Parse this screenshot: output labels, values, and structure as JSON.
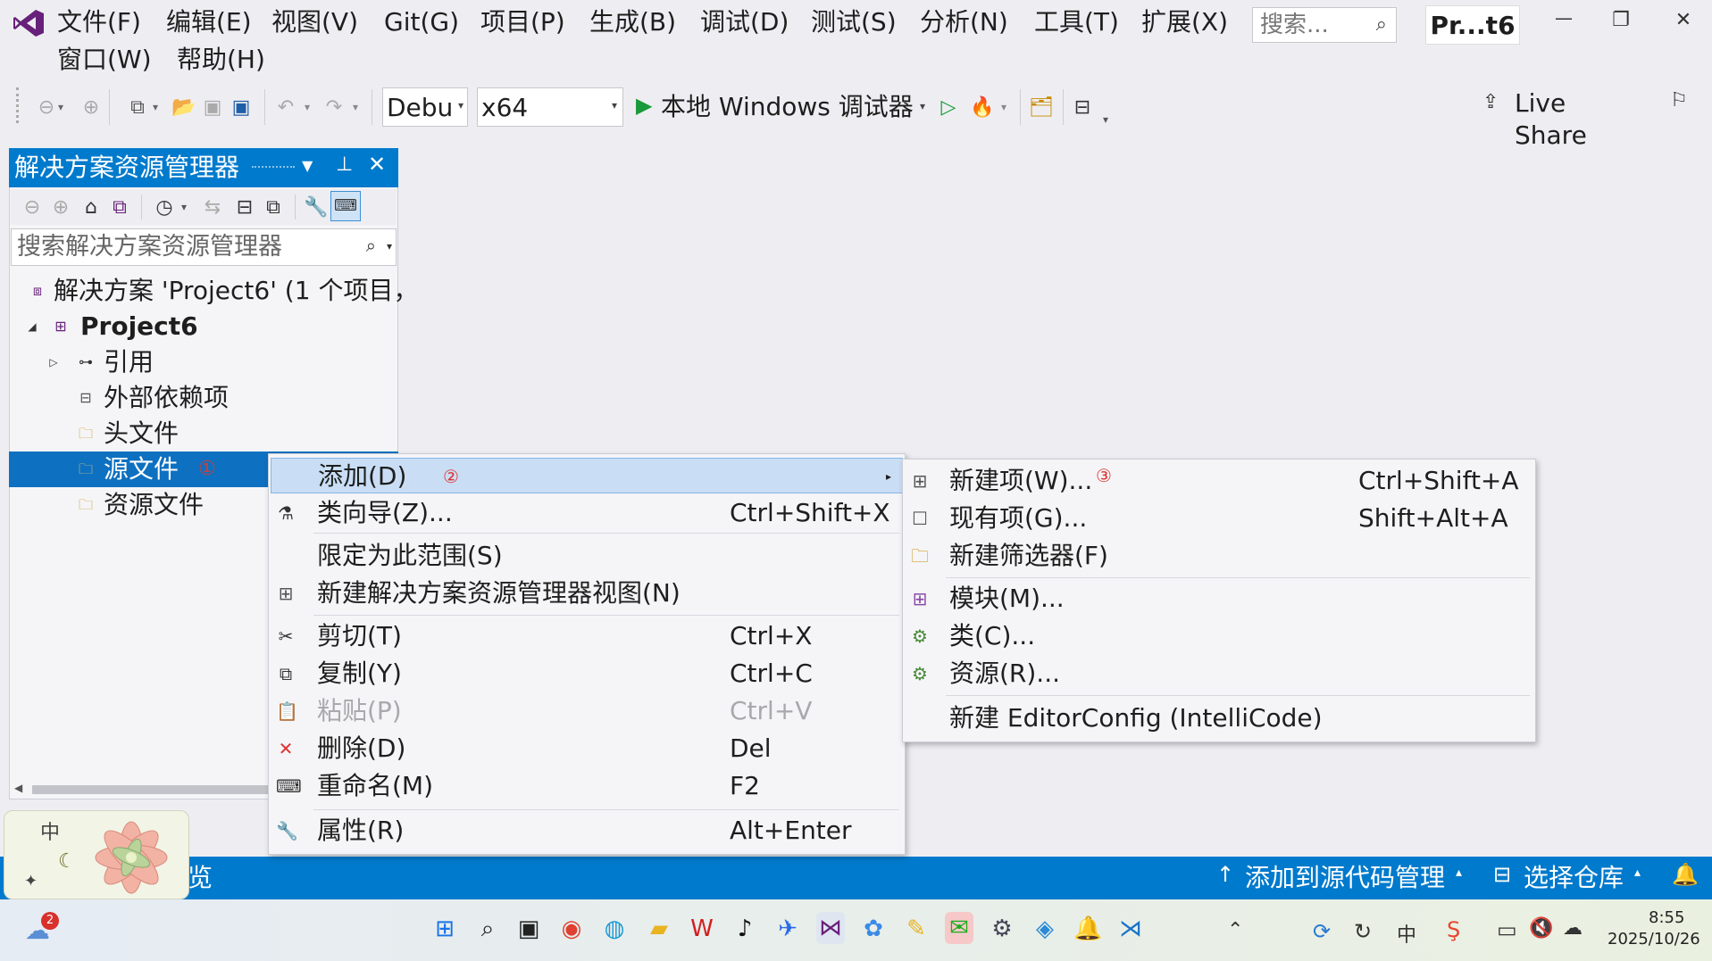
{
  "menubar": {
    "items": [
      "文件(F)",
      "编辑(E)",
      "视图(V)",
      "Git(G)",
      "项目(P)",
      "生成(B)",
      "调试(D)",
      "测试(S)",
      "分析(N)",
      "工具(T)",
      "扩展(X)"
    ],
    "items_row2": [
      "窗口(W)",
      "帮助(H)"
    ],
    "search_placeholder": "搜索...",
    "project_badge": "Pr...t6",
    "window_min": "—",
    "window_restore": "❐",
    "window_close": "✕"
  },
  "toolbar": {
    "config": "Debu",
    "platform": "x64",
    "run_label": "本地 Windows 调试器",
    "live_share": "Live Share"
  },
  "solution_explorer": {
    "title": "解决方案资源管理器",
    "search_placeholder": "搜索解决方案资源管理器(Ctrl+;)",
    "search_icon": "magnifier-icon",
    "solution_label": "解决方案 'Project6' (1 个项目，",
    "project": "Project6",
    "items": [
      "引用",
      "外部依赖项",
      "头文件",
      "源文件",
      "资源文件"
    ],
    "selected_marker": "①"
  },
  "context_menu": {
    "items": [
      {
        "label": "添加(D)",
        "marker": "②",
        "shortcut": "",
        "icon": "",
        "submenu": true
      },
      {
        "label": "类向导(Z)...",
        "shortcut": "Ctrl+Shift+X",
        "icon": "class-wizard-icon"
      },
      {
        "label": "限定为此范围(S)",
        "shortcut": "",
        "icon": ""
      },
      {
        "label": "新建解决方案资源管理器视图(N)",
        "shortcut": "",
        "icon": "new-view-icon"
      },
      {
        "label": "剪切(T)",
        "shortcut": "Ctrl+X",
        "icon": "scissors-icon"
      },
      {
        "label": "复制(Y)",
        "shortcut": "Ctrl+C",
        "icon": "copy-icon"
      },
      {
        "label": "粘贴(P)",
        "shortcut": "Ctrl+V",
        "icon": "paste-icon",
        "disabled": true
      },
      {
        "label": "删除(D)",
        "shortcut": "Del",
        "icon": "delete-icon"
      },
      {
        "label": "重命名(M)",
        "shortcut": "F2",
        "icon": "rename-icon"
      },
      {
        "label": "属性(R)",
        "shortcut": "Alt+Enter",
        "icon": "wrench-icon"
      }
    ]
  },
  "submenu": {
    "items": [
      {
        "label": "新建项(W)...",
        "marker": "③",
        "shortcut": "Ctrl+Shift+A",
        "icon": "new-item-icon"
      },
      {
        "label": "现有项(G)...",
        "shortcut": "Shift+Alt+A",
        "icon": "existing-item-icon"
      },
      {
        "label": "新建筛选器(F)",
        "shortcut": "",
        "icon": "folder-icon"
      },
      {
        "label": "模块(M)...",
        "shortcut": "",
        "icon": "module-icon"
      },
      {
        "label": "类(C)...",
        "shortcut": "",
        "icon": "class-icon"
      },
      {
        "label": "资源(R)...",
        "shortcut": "",
        "icon": "resource-icon"
      },
      {
        "label": "新建 EditorConfig (IntelliCode)",
        "shortcut": "",
        "icon": ""
      }
    ]
  },
  "statusbar": {
    "left_text": "览",
    "add_to_source": "添加到源代码管理",
    "select_repo": "选择仓库"
  },
  "ime_widget": {
    "char": "中"
  },
  "taskbar": {
    "weather_badge": "2",
    "tray_lang": "中",
    "time": "8:55",
    "date": "2025/10/26"
  },
  "colors": {
    "accent": "#007acc",
    "selection": "#0e70c0",
    "menu_highlight": "#c9def5",
    "vs_purple": "#68217a",
    "marker_red": "#e03030"
  }
}
